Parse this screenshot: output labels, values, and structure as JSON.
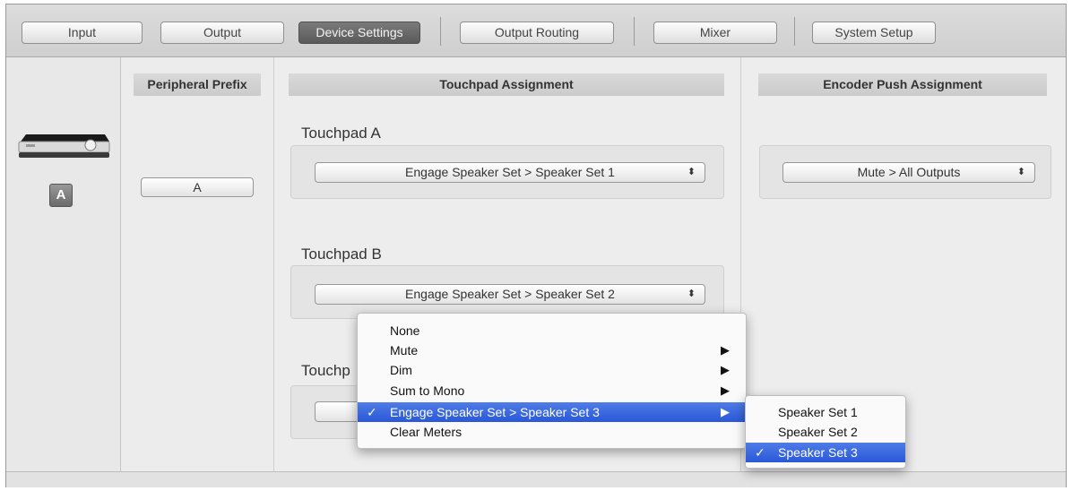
{
  "toolbar": {
    "tabs": [
      "Input",
      "Output",
      "Device Settings",
      "Output Routing",
      "Mixer",
      "System Setup"
    ]
  },
  "device": {
    "badge": "A"
  },
  "prefix": {
    "header": "Peripheral Prefix",
    "value": "A"
  },
  "touchpad": {
    "header": "Touchpad Assignment",
    "a_title": "Touchpad A",
    "a_value": "Engage Speaker Set > Speaker Set 1",
    "b_title": "Touchpad B",
    "b_value": "Engage Speaker Set > Speaker Set 2",
    "c_title": "Touchp",
    "arrows": "⬍"
  },
  "encoder": {
    "header": "Encoder Push Assignment",
    "value": "Mute > All Outputs"
  },
  "menu": {
    "items": [
      "None",
      "Mute",
      "Dim",
      "Sum to Mono",
      "Engage Speaker Set > Speaker Set 3",
      "Clear Meters"
    ],
    "check": "✓",
    "submenu_arrow": "▶"
  },
  "submenu": {
    "items": [
      "Speaker Set 1",
      "Speaker Set 2",
      "Speaker Set 3"
    ]
  },
  "colors": {
    "selection": "#2a58d8",
    "active_tab": "#5a5a5a"
  }
}
